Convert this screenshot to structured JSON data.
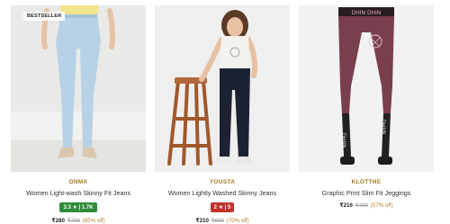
{
  "products": [
    {
      "badge": "BESTSELLER",
      "brand": "DNMX",
      "title": "Women Light-wash Skinny Fit Jeans",
      "rating": "3.3 ★ | 1.7K",
      "price": "₹280",
      "mrp": "₹799",
      "discount": "(65% off)",
      "brand_color": "#a3781e",
      "rating_color": "#2e8b3a"
    },
    {
      "badge": "",
      "brand": "YOUSTA",
      "title": "Women Lightly Washed Skinny Jeans",
      "rating": "2 ★ | 5",
      "price": "₹210",
      "mrp": "₹699",
      "discount": "(70% off)",
      "brand_color": "#a3781e",
      "rating_color": "#c1322d"
    },
    {
      "badge": "",
      "brand": "KLOTTHE",
      "title": "Graphic Print Slim Fit Jeggings",
      "rating": "",
      "price": "₹216",
      "mrp": "₹499",
      "discount": "(57% off)",
      "brand_color": "#a3781e",
      "rating_color": ""
    }
  ],
  "print_text": {
    "waistband": "DHIN DHIN",
    "leg_left": "DHIIN",
    "leg_right": "DHIIN"
  }
}
